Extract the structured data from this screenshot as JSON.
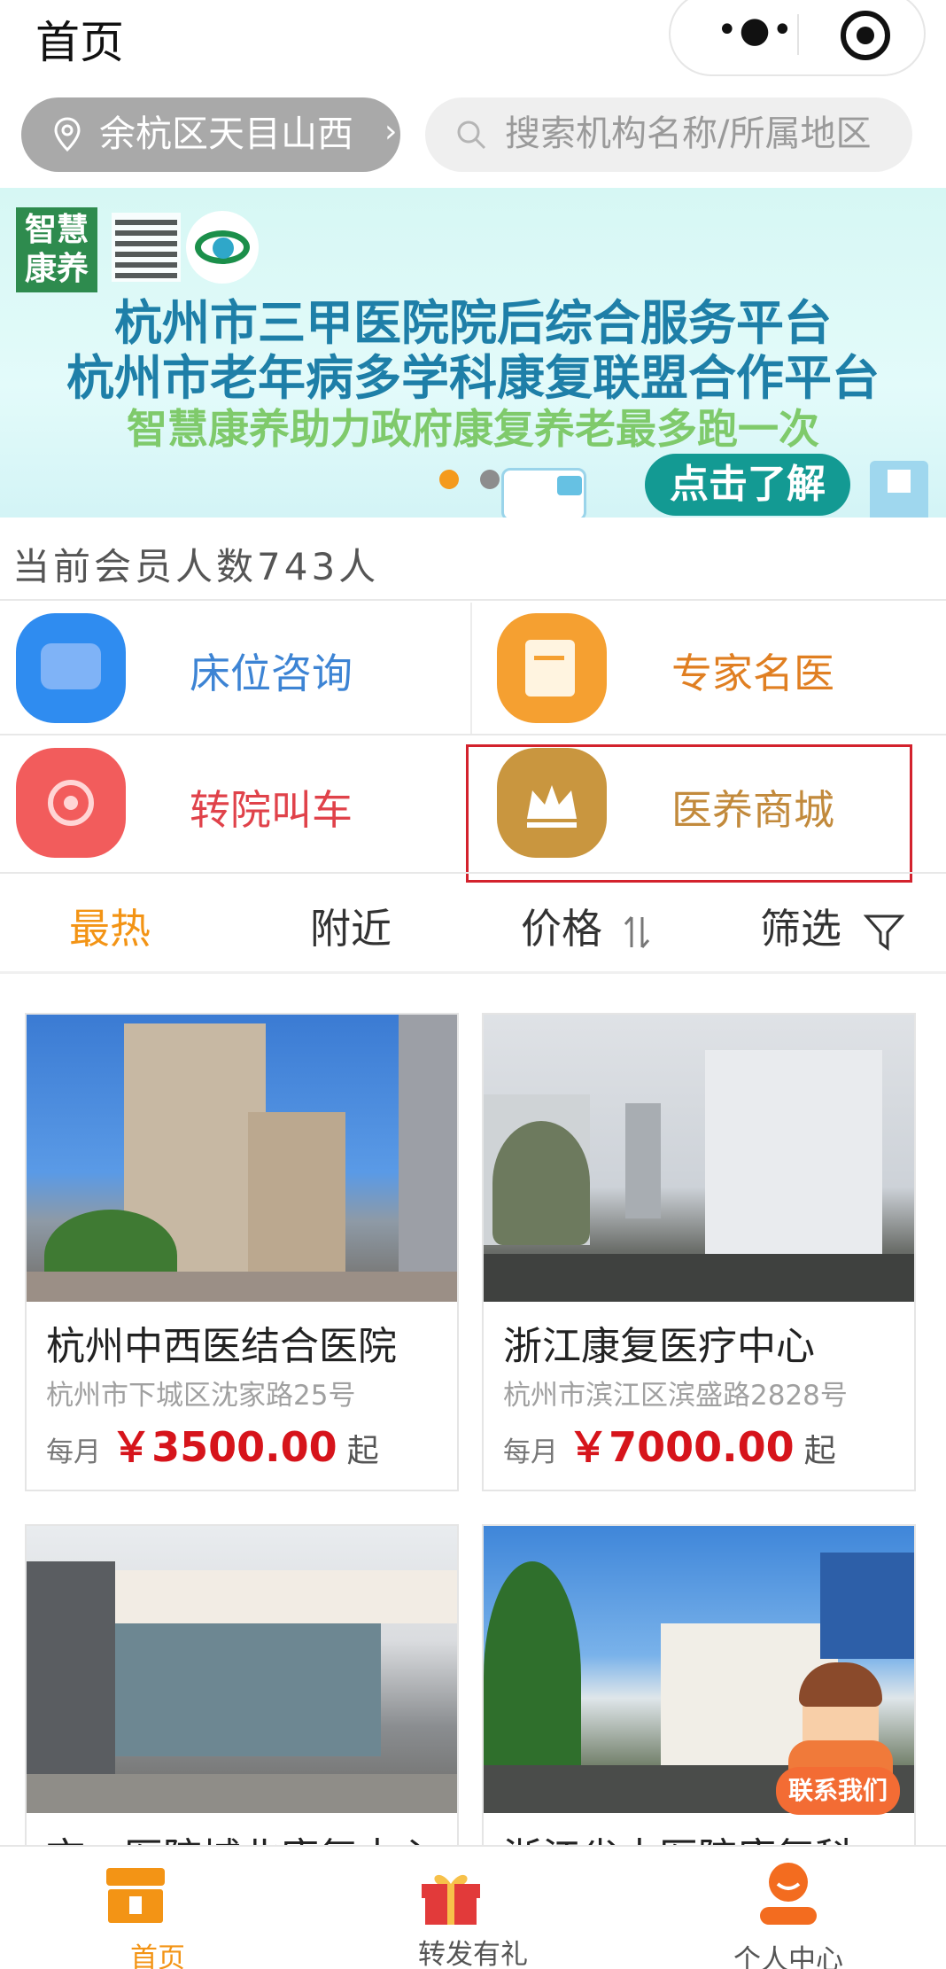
{
  "header": {
    "title": "首页"
  },
  "location": {
    "label": "余杭区天目山西",
    "arrow": "›"
  },
  "search": {
    "placeholder": "搜索机构名称/所属地区"
  },
  "banner": {
    "logo_text": "智慧康养",
    "line1": "杭州市三甲医院院后综合服务平台",
    "line2": "杭州市老年病多学科康复联盟合作平台",
    "line3": "智慧康养助力政府康复养老最多跑一次",
    "button": "点击了解",
    "active_dot": 1,
    "dot_count": 2
  },
  "member_count_text": "当前会员人数743人",
  "menu": [
    {
      "label": "床位咨询",
      "icon": "bed-icon",
      "color": "#3d84d4",
      "icon_color": "#2f8cf0"
    },
    {
      "label": "专家名医",
      "icon": "document-icon",
      "color": "#e07f22",
      "icon_color": "#f5a031"
    },
    {
      "label": "转院叫车",
      "icon": "target-icon",
      "color": "#e0424a",
      "icon_color": "#f25c5c"
    },
    {
      "label": "医养商城",
      "icon": "crown-icon",
      "color": "#c28a3c",
      "icon_color": "#c9963f"
    }
  ],
  "filters": {
    "hot": "最热",
    "nearby": "附近",
    "price": "价格",
    "price_icon": "sort-icon",
    "filter": "筛选",
    "filter_icon": "funnel-icon"
  },
  "cards": [
    {
      "name": "杭州中西医结合医院",
      "address": "杭州市下城区沈家路25号",
      "prefix": "每月",
      "price": "￥3500.00",
      "suffix": "起"
    },
    {
      "name": "浙江康复医疗中心",
      "address": "杭州市滨江区滨盛路2828号",
      "prefix": "每月",
      "price": "￥7000.00",
      "suffix": "起"
    },
    {
      "name": "市一医院城北康复中心",
      "address": "",
      "prefix": "",
      "price": "",
      "suffix": ""
    },
    {
      "name": "浙江省中医院康复科",
      "address": "",
      "prefix": "",
      "price": "",
      "suffix": ""
    }
  ],
  "contact": {
    "label": "联系我们"
  },
  "bottom_nav": [
    {
      "label": "首页",
      "icon": "home-icon",
      "active": true
    },
    {
      "label": "转发有礼",
      "icon": "gift-icon",
      "active": false
    },
    {
      "label": "个人中心",
      "icon": "user-icon",
      "active": false
    }
  ],
  "colors": {
    "accent": "#f39415",
    "price": "#d6141b",
    "highlight_box": "#d3222d"
  }
}
